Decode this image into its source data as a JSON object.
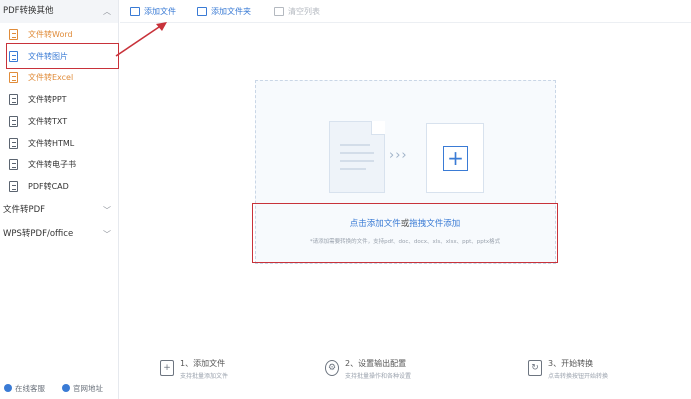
{
  "sidebar": {
    "group1": {
      "label": "PDF转换其他"
    },
    "items": [
      {
        "label": "文件转Word",
        "variant": "orange"
      },
      {
        "label": "文件转图片",
        "variant": "selected"
      },
      {
        "label": "文件转Excel",
        "variant": "orange"
      },
      {
        "label": "文件转PPT",
        "variant": "normal"
      },
      {
        "label": "文件转TXT",
        "variant": "normal"
      },
      {
        "label": "文件转HTML",
        "variant": "normal"
      },
      {
        "label": "文件转电子书",
        "variant": "normal"
      },
      {
        "label": "PDF转CAD",
        "variant": "normal"
      }
    ],
    "group2": {
      "label": "文件转PDF"
    },
    "group3": {
      "label": "WPS转PDF/office"
    },
    "footer": {
      "service": "在线客服",
      "website": "官网地址"
    }
  },
  "toolbar": {
    "add_file": "添加文件",
    "add_folder": "添加文件夹",
    "clear_list": "清空列表"
  },
  "dropzone": {
    "main_prefix": "点击添加文件",
    "main_or": "或",
    "main_suffix": "拖拽文件添加",
    "hint": "*请添加需要转换的文件，支持pdf、doc、docx、xls、xlsx、ppt、pptx格式"
  },
  "steps": [
    {
      "title": "1、添加文件",
      "desc": "支持批量添加文件"
    },
    {
      "title": "2、设置输出配置",
      "desc": "支持批量操作和各种设置"
    },
    {
      "title": "3、开始转换",
      "desc": "点击转换按钮开始转换"
    }
  ],
  "colors": {
    "accent": "#3a7bd5",
    "highlight": "#c8323a",
    "orange": "#e08c3a"
  }
}
